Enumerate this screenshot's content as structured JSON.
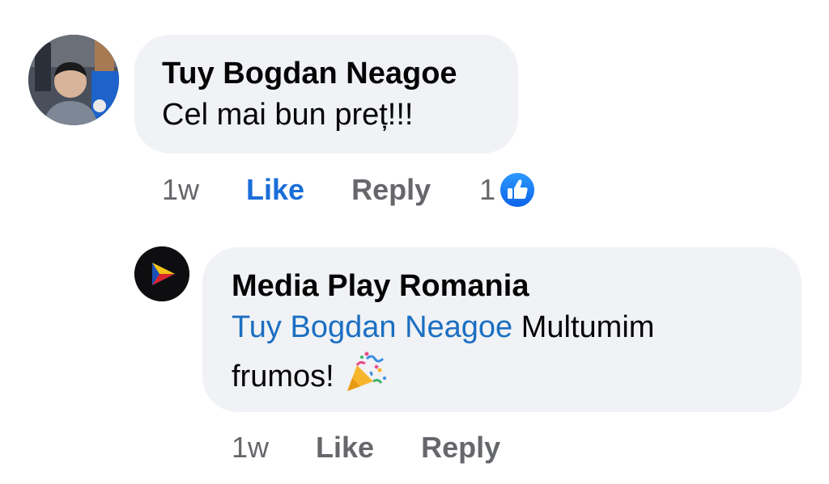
{
  "comment": {
    "author": "Tuy Bogdan Neagoe",
    "text": "Cel mai bun preț!!!",
    "time": "1w",
    "like_label": "Like",
    "reply_label": "Reply",
    "reaction_count": "1",
    "reaction_icon": "like-reaction-icon",
    "like_active": true
  },
  "reply": {
    "author": "Media Play Romania",
    "mention": "Tuy Bogdan Neagoe",
    "text_line1": " Multumim",
    "text_line2": "frumos! ",
    "emoji": "party-popper-icon",
    "time": "1w",
    "like_label": "Like",
    "reply_label": "Reply"
  },
  "colors": {
    "bubble": "#f0f2f5",
    "mention": "#1b6fc2",
    "like_active": "#1a6ed8",
    "meta": "#65676b"
  }
}
